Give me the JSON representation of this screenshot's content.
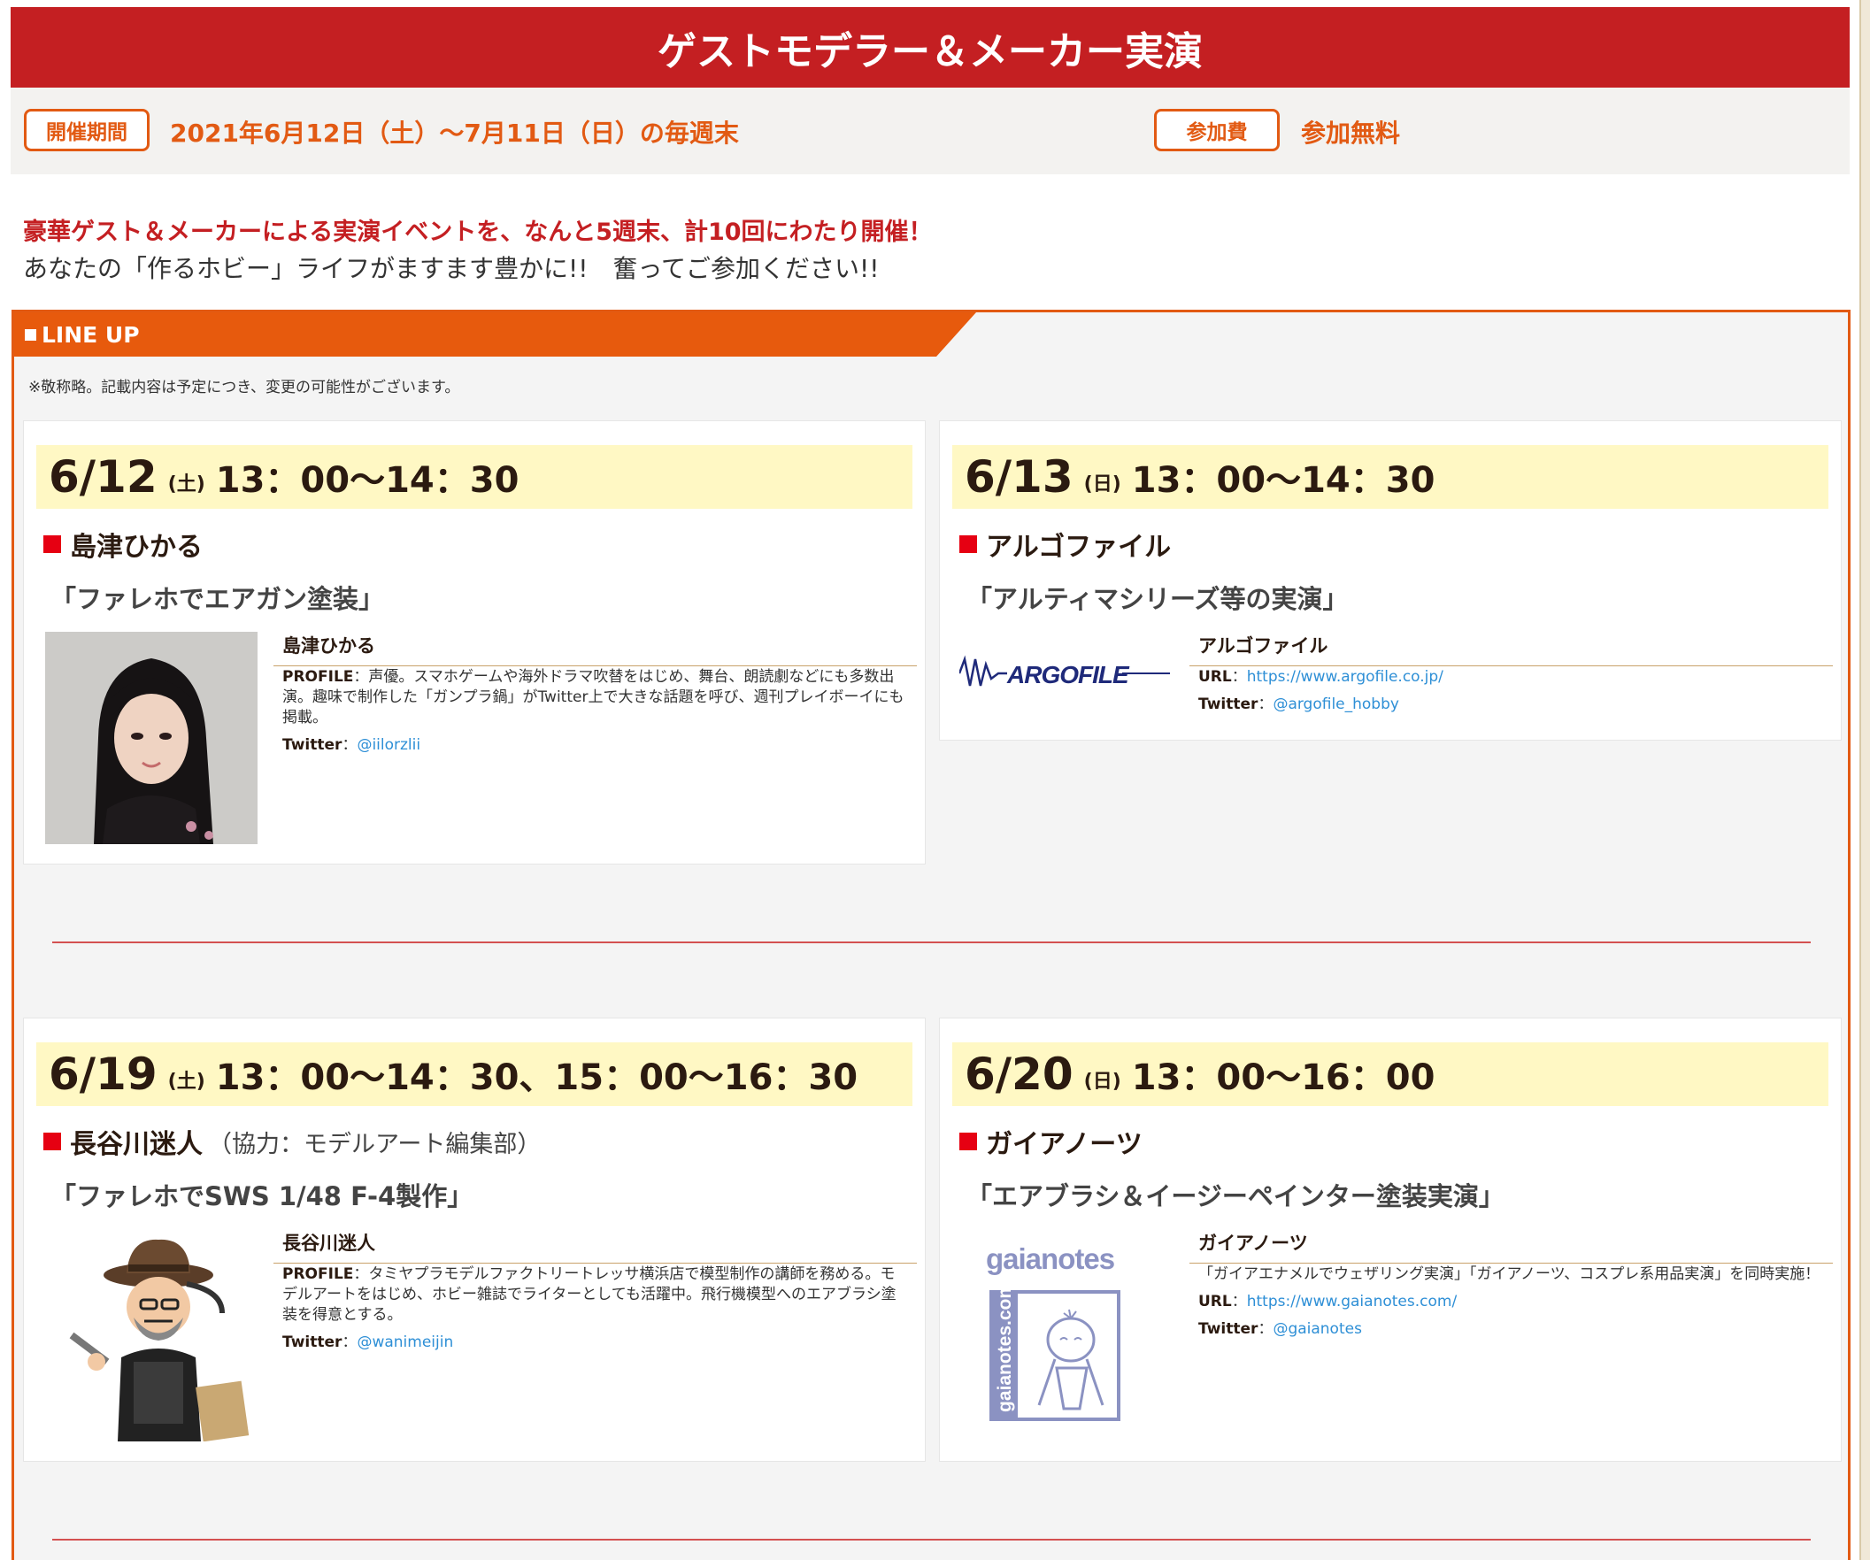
{
  "banner": {
    "title": "ゲストモデラー＆メーカー実演"
  },
  "info": {
    "period_label": "開催期間",
    "period_value": "2021年6月12日（土）～7月11日（日）の毎週末",
    "fee_label": "参加費",
    "fee_value": "参加無料"
  },
  "intro": {
    "line1": "豪華ゲスト＆メーカーによる実演イベントを、なんと5週末、計10回にわたり開催！",
    "line2": "あなたの「作るホビー」ライフがますます豊かに!!　奮ってご参加ください!!"
  },
  "lineup": {
    "heading": "LINE UP",
    "note": "※敬称略。記載内容は予定につき、変更の可能性がございます。",
    "cards": [
      {
        "date": "6/12",
        "weekday": "(土)",
        "time": "13：00～14：30",
        "name": "島津ひかる",
        "name_extra": "",
        "subtitle": "「ファレホでエアガン塗装」",
        "profile_name": "島津ひかる",
        "profile_label": "PROFILE",
        "profile_text": "：声優。スマホゲームや海外ドラマ吹替をはじめ、舞台、朗読劇などにも多数出演。趣味で制作した「ガンプラ鍋」がTwitter上で大きな話題を呼び、週刊プレイボーイにも掲載。",
        "twitter_label": "Twitter",
        "twitter": "@iilorzlii",
        "image": "portrait-photo"
      },
      {
        "date": "6/13",
        "weekday": "(日)",
        "time": "13：00～14：30",
        "name": "アルゴファイル",
        "name_extra": "",
        "subtitle": "「アルティマシリーズ等の実演」",
        "profile_name": "アルゴファイル",
        "url_label": "URL",
        "url": "https://www.argofile.co.jp/",
        "twitter_label": "Twitter",
        "twitter": "@argofile_hobby",
        "logo_text": "ARGOFILE"
      },
      {
        "date": "6/19",
        "weekday": "(土)",
        "time": "13：00～14：30、15：00～16：30",
        "name": "長谷川迷人",
        "name_extra": "（協力：モデルアート編集部）",
        "subtitle": "「ファレホでSWS 1/48 F-4製作」",
        "profile_name": "長谷川迷人",
        "profile_label": "PROFILE",
        "profile_text": "：タミヤプラモデルファクトリートレッサ横浜店で模型制作の講師を務める。モデルアートをはじめ、ホビー雑誌でライターとしても活躍中。飛行機模型へのエアブラシ塗装を得意とする。",
        "twitter_label": "Twitter",
        "twitter": "@wanimeijin",
        "image": "caricature-illustration"
      },
      {
        "date": "6/20",
        "weekday": "(日)",
        "time": "13：00～16：00",
        "name": "ガイアノーツ",
        "name_extra": "",
        "subtitle": "「エアブラシ＆イージーペインター塗装実演」",
        "profile_name": "ガイアノーツ",
        "desc": "「ガイアエナメルでウェザリング実演」「ガイアノーツ、コスプレ系用品実演」を同時実施！",
        "url_label": "URL",
        "url": "https://www.gaianotes.com/",
        "twitter_label": "Twitter",
        "twitter": "@gaianotes",
        "logo_text": "gaianotes",
        "logo_side_text": "gaianotes.com"
      }
    ]
  },
  "colors": {
    "banner": "#c41f22",
    "accent": "#e25a13",
    "date_bg": "#fff8c4",
    "link": "#2e8fd6"
  }
}
